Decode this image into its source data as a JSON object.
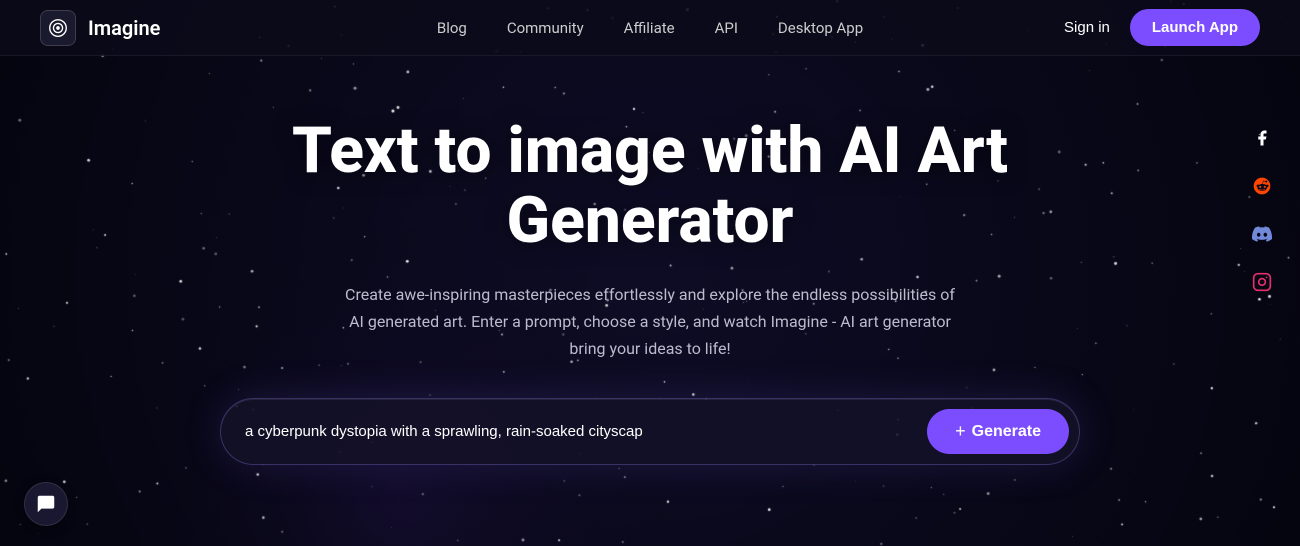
{
  "logo": {
    "text": "Imagine"
  },
  "nav": {
    "links": [
      {
        "label": "Blog",
        "name": "blog"
      },
      {
        "label": "Community",
        "name": "community"
      },
      {
        "label": "Affiliate",
        "name": "affiliate"
      },
      {
        "label": "API",
        "name": "api"
      },
      {
        "label": "Desktop App",
        "name": "desktop-app"
      }
    ],
    "sign_in": "Sign in",
    "launch_app": "Launch App"
  },
  "hero": {
    "title": "Text to image with AI Art Generator",
    "subtitle": "Create awe-inspiring masterpieces effortlessly and explore the endless possibilities of AI generated art. Enter a prompt, choose a style, and watch Imagine - AI art generator bring your ideas to life!"
  },
  "search": {
    "placeholder": "a cyberpunk dystopia with a sprawling, rain-soaked cityscap",
    "value": "a cyberpunk dystopia with a sprawling, rain-soaked cityscap",
    "generate_label": "Generate",
    "plus_symbol": "+"
  },
  "social": {
    "items": [
      {
        "name": "facebook",
        "symbol": "f"
      },
      {
        "name": "reddit",
        "symbol": "r"
      },
      {
        "name": "discord",
        "symbol": "d"
      },
      {
        "name": "instagram",
        "symbol": "i"
      }
    ]
  },
  "chat": {
    "icon_label": "chat"
  }
}
